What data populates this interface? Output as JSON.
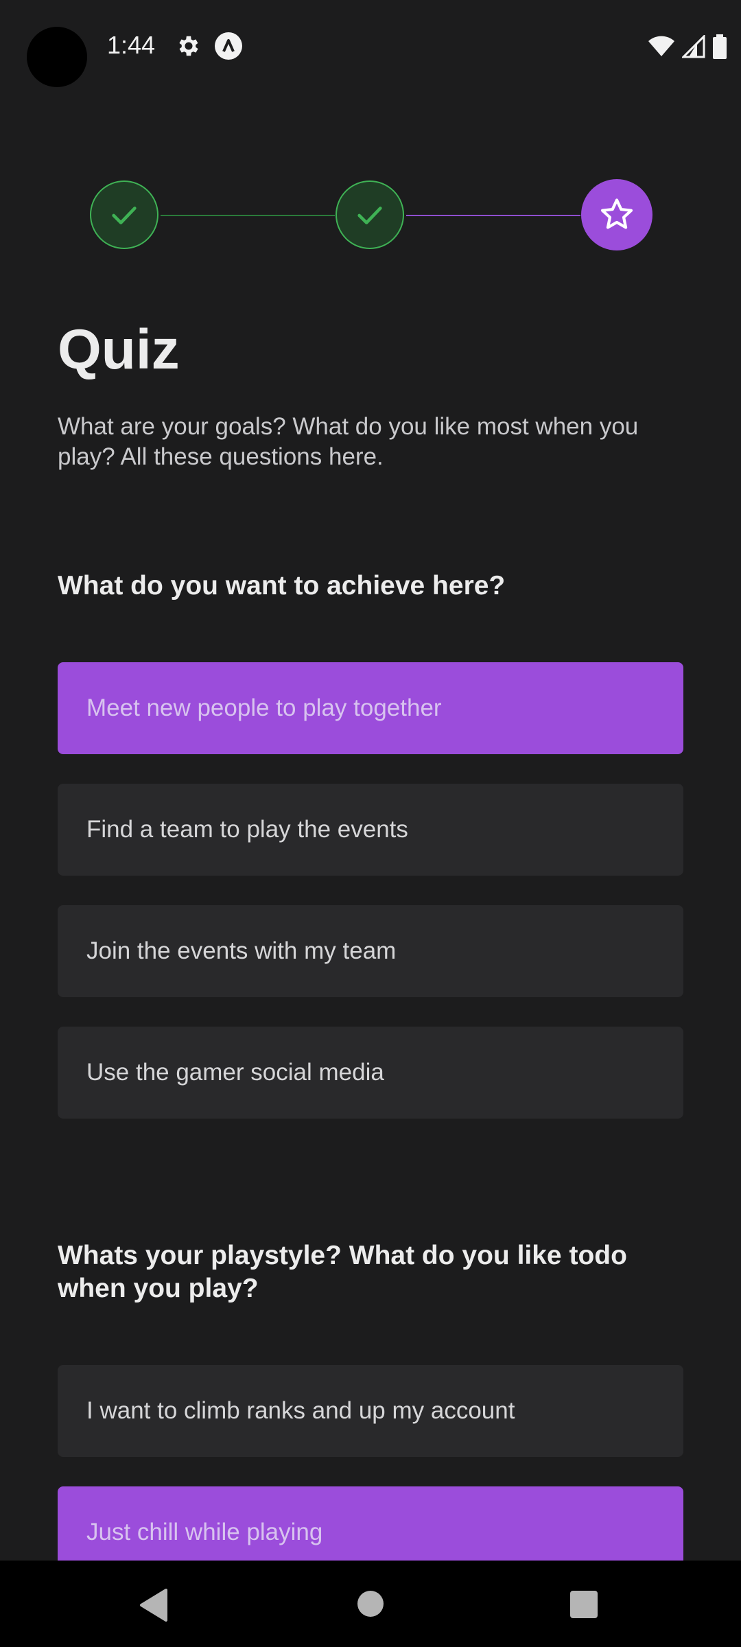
{
  "status_bar": {
    "time": "1:44"
  },
  "stepper": {
    "steps": [
      {
        "state": "completed",
        "icon": "check-icon"
      },
      {
        "state": "completed",
        "icon": "check-icon"
      },
      {
        "state": "active",
        "icon": "star-icon"
      }
    ]
  },
  "page": {
    "title": "Quiz",
    "subtitle": "What are your goals? What do you like most when you play? All these questions here."
  },
  "questions": [
    {
      "text": "What do you want to achieve here?",
      "options": [
        {
          "label": "Meet new people to play together",
          "selected": true
        },
        {
          "label": "Find a team to play the events",
          "selected": false
        },
        {
          "label": "Join the events with my team",
          "selected": false
        },
        {
          "label": "Use the gamer social media",
          "selected": false
        }
      ]
    },
    {
      "text": "Whats your playstyle? What do you like todo when you play?",
      "options": [
        {
          "label": "I want to climb ranks and up my account",
          "selected": false
        },
        {
          "label": "Just chill while playing",
          "selected": true
        }
      ]
    }
  ],
  "colors": {
    "accent": "#9b4ddb",
    "success": "#3fb255",
    "background": "#1c1c1d",
    "option_background": "#29292b"
  }
}
